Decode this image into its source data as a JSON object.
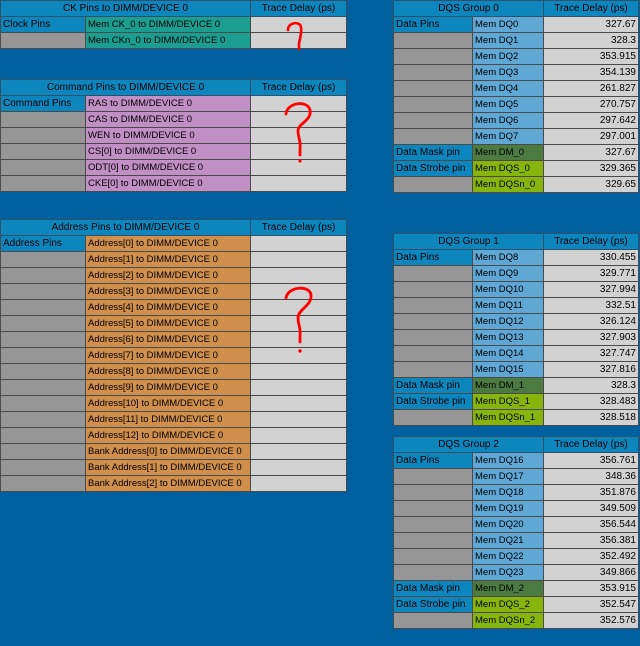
{
  "page": {
    "background_color": "#0060a0",
    "title_header_color": "#0d86bd",
    "value_cell_color": "#d2d2d2",
    "empty_cell_color": "#969696",
    "annotation_color": "#ff0000"
  },
  "common": {
    "trace_delay_header": "Trace Delay (ps)"
  },
  "tables": [
    {
      "id": "ck-pins",
      "title": "CK Pins to DIMM/DEVICE 0",
      "delay_header": "Trace Delay (ps)",
      "rows": [
        {
          "group": "Clock Pins",
          "name": "Mem CK_0 to DIMM/DEVICE 0",
          "name_color": "teal",
          "value": ""
        },
        {
          "group": "",
          "name": "Mem CKn_0 to DIMM/DEVICE 0",
          "name_color": "teal",
          "value": ""
        }
      ]
    },
    {
      "id": "command-pins",
      "title": "Command Pins to DIMM/DEVICE 0",
      "delay_header": "Trace Delay (ps)",
      "rows": [
        {
          "group": "Command Pins",
          "name": "RAS to DIMM/DEVICE 0",
          "name_color": "purple",
          "value": ""
        },
        {
          "group": "",
          "name": "CAS to DIMM/DEVICE 0",
          "name_color": "purple",
          "value": ""
        },
        {
          "group": "",
          "name": "WEN to DIMM/DEVICE 0",
          "name_color": "purple",
          "value": ""
        },
        {
          "group": "",
          "name": "CS[0] to DIMM/DEVICE 0",
          "name_color": "purple",
          "value": ""
        },
        {
          "group": "",
          "name": "ODT[0] to DIMM/DEVICE 0",
          "name_color": "purple",
          "value": ""
        },
        {
          "group": "",
          "name": "CKE[0] to DIMM/DEVICE 0",
          "name_color": "purple",
          "value": ""
        }
      ]
    },
    {
      "id": "address-pins",
      "title": "Address Pins to DIMM/DEVICE 0",
      "delay_header": "Trace Delay (ps)",
      "rows": [
        {
          "group": "Address Pins",
          "name": "Address[0] to DIMM/DEVICE 0",
          "name_color": "orange",
          "value": ""
        },
        {
          "group": "",
          "name": "Address[1] to DIMM/DEVICE 0",
          "name_color": "orange",
          "value": ""
        },
        {
          "group": "",
          "name": "Address[2] to DIMM/DEVICE 0",
          "name_color": "orange",
          "value": ""
        },
        {
          "group": "",
          "name": "Address[3] to DIMM/DEVICE 0",
          "name_color": "orange",
          "value": ""
        },
        {
          "group": "",
          "name": "Address[4] to DIMM/DEVICE 0",
          "name_color": "orange",
          "value": ""
        },
        {
          "group": "",
          "name": "Address[5] to DIMM/DEVICE 0",
          "name_color": "orange",
          "value": ""
        },
        {
          "group": "",
          "name": "Address[6] to DIMM/DEVICE 0",
          "name_color": "orange",
          "value": ""
        },
        {
          "group": "",
          "name": "Address[7] to DIMM/DEVICE 0",
          "name_color": "orange",
          "value": ""
        },
        {
          "group": "",
          "name": "Address[8] to DIMM/DEVICE 0",
          "name_color": "orange",
          "value": ""
        },
        {
          "group": "",
          "name": "Address[9] to DIMM/DEVICE 0",
          "name_color": "orange",
          "value": ""
        },
        {
          "group": "",
          "name": "Address[10] to DIMM/DEVICE 0",
          "name_color": "orange",
          "value": ""
        },
        {
          "group": "",
          "name": "Address[11] to DIMM/DEVICE 0",
          "name_color": "orange",
          "value": ""
        },
        {
          "group": "",
          "name": "Address[12] to DIMM/DEVICE 0",
          "name_color": "orange",
          "value": ""
        },
        {
          "group": "",
          "name": "Bank Address[0] to DIMM/DEVICE 0",
          "name_color": "orange",
          "value": ""
        },
        {
          "group": "",
          "name": "Bank Address[1] to DIMM/DEVICE 0",
          "name_color": "orange",
          "value": ""
        },
        {
          "group": "",
          "name": "Bank Address[2] to DIMM/DEVICE 0",
          "name_color": "orange",
          "value": ""
        }
      ]
    },
    {
      "id": "dqs-group-0",
      "title": "DQS Group 0",
      "delay_header": "Trace Delay (ps)",
      "rows": [
        {
          "group": "Data Pins",
          "name": "Mem DQ0",
          "name_color": "blue",
          "value": "327.67"
        },
        {
          "group": "",
          "name": "Mem DQ1",
          "name_color": "blue",
          "value": "328.3"
        },
        {
          "group": "",
          "name": "Mem DQ2",
          "name_color": "blue",
          "value": "353.915"
        },
        {
          "group": "",
          "name": "Mem DQ3",
          "name_color": "blue",
          "value": "354.139"
        },
        {
          "group": "",
          "name": "Mem DQ4",
          "name_color": "blue",
          "value": "261.827"
        },
        {
          "group": "",
          "name": "Mem DQ5",
          "name_color": "blue",
          "value": "270.757"
        },
        {
          "group": "",
          "name": "Mem DQ6",
          "name_color": "blue",
          "value": "297.642"
        },
        {
          "group": "",
          "name": "Mem DQ7",
          "name_color": "blue",
          "value": "297.001"
        },
        {
          "group": "Data Mask pin",
          "name": "Mem DM_0",
          "name_color": "darkgreen",
          "value": "327.67"
        },
        {
          "group": "Data Strobe pin",
          "name": "Mem DQS_0",
          "name_color": "limegreen",
          "value": "329.365"
        },
        {
          "group": "",
          "name": "Mem DQSn_0",
          "name_color": "limegreen",
          "value": "329.65"
        }
      ]
    },
    {
      "id": "dqs-group-1",
      "title": "DQS Group 1",
      "delay_header": "Trace Delay (ps)",
      "rows": [
        {
          "group": "Data Pins",
          "name": "Mem DQ8",
          "name_color": "blue",
          "value": "330.455"
        },
        {
          "group": "",
          "name": "Mem DQ9",
          "name_color": "blue",
          "value": "329.771"
        },
        {
          "group": "",
          "name": "Mem DQ10",
          "name_color": "blue",
          "value": "327.994"
        },
        {
          "group": "",
          "name": "Mem DQ11",
          "name_color": "blue",
          "value": "332.51"
        },
        {
          "group": "",
          "name": "Mem DQ12",
          "name_color": "blue",
          "value": "326.124"
        },
        {
          "group": "",
          "name": "Mem DQ13",
          "name_color": "blue",
          "value": "327.903"
        },
        {
          "group": "",
          "name": "Mem DQ14",
          "name_color": "blue",
          "value": "327.747"
        },
        {
          "group": "",
          "name": "Mem DQ15",
          "name_color": "blue",
          "value": "327.816"
        },
        {
          "group": "Data Mask pin",
          "name": "Mem DM_1",
          "name_color": "darkgreen",
          "value": "328.3"
        },
        {
          "group": "Data Strobe pin",
          "name": "Mem DQS_1",
          "name_color": "limegreen",
          "value": "328.483"
        },
        {
          "group": "",
          "name": "Mem DQSn_1",
          "name_color": "limegreen",
          "value": "328.518"
        }
      ]
    },
    {
      "id": "dqs-group-2",
      "title": "DQS Group 2",
      "delay_header": "Trace Delay (ps)",
      "rows": [
        {
          "group": "Data Pins",
          "name": "Mem DQ16",
          "name_color": "blue",
          "value": "356.761"
        },
        {
          "group": "",
          "name": "Mem DQ17",
          "name_color": "blue",
          "value": "348.36"
        },
        {
          "group": "",
          "name": "Mem DQ18",
          "name_color": "blue",
          "value": "351.876"
        },
        {
          "group": "",
          "name": "Mem DQ19",
          "name_color": "blue",
          "value": "349.509"
        },
        {
          "group": "",
          "name": "Mem DQ20",
          "name_color": "blue",
          "value": "356.544"
        },
        {
          "group": "",
          "name": "Mem DQ21",
          "name_color": "blue",
          "value": "356.381"
        },
        {
          "group": "",
          "name": "Mem DQ22",
          "name_color": "blue",
          "value": "352.492"
        },
        {
          "group": "",
          "name": "Mem DQ23",
          "name_color": "blue",
          "value": "349.866"
        },
        {
          "group": "Data Mask pin",
          "name": "Mem DM_2",
          "name_color": "darkgreen",
          "value": "353.915"
        },
        {
          "group": "Data Strobe pin",
          "name": "Mem DQS_2",
          "name_color": "limegreen",
          "value": "352.547"
        },
        {
          "group": "",
          "name": "Mem DQSn_2",
          "name_color": "limegreen",
          "value": "352.576"
        }
      ]
    }
  ],
  "annotations": [
    {
      "id": "question-mark-ck",
      "symbol": "?",
      "target_table": "ck-pins"
    },
    {
      "id": "question-mark-command",
      "symbol": "?",
      "target_table": "command-pins"
    },
    {
      "id": "question-mark-address",
      "symbol": "?",
      "target_table": "address-pins"
    }
  ]
}
